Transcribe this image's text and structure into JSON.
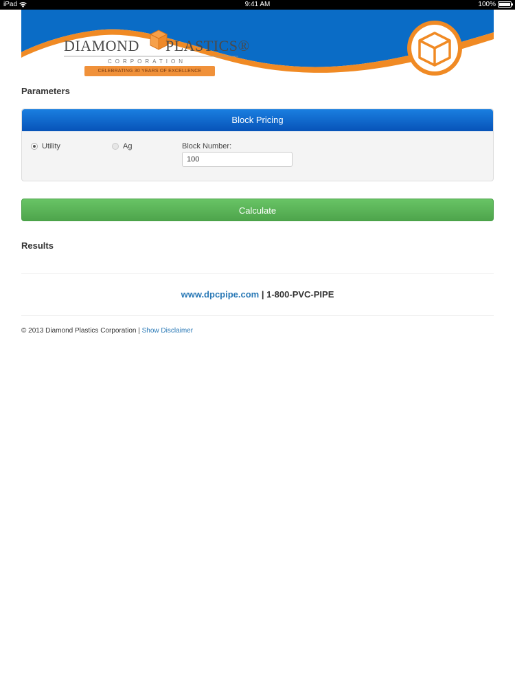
{
  "status_bar": {
    "device": "iPad",
    "time": "9:41 AM",
    "battery": "100%"
  },
  "header": {
    "logo_left": "DIAMOND",
    "logo_right": "PLASTICS®",
    "logo_sub": "CORPORATION",
    "ribbon": "CELEBRATING 30 YEARS OF EXCELLENCE",
    "colors": {
      "blue": "#0a6cc6",
      "orange": "#f08a24"
    }
  },
  "parameters": {
    "title": "Parameters",
    "panel_title": "Block Pricing",
    "radio_options": [
      {
        "label": "Utility",
        "selected": true
      },
      {
        "label": "Ag",
        "selected": false
      }
    ],
    "block_number_label": "Block Number:",
    "block_number_value": "100"
  },
  "actions": {
    "calculate_label": "Calculate"
  },
  "results": {
    "title": "Results"
  },
  "contact": {
    "website": "www.dpcpipe.com",
    "separator": " | ",
    "phone": "1-800-PVC-PIPE"
  },
  "footer": {
    "copyright": "© 2013 Diamond Plastics Corporation | ",
    "disclaimer_link": "Show Disclaimer"
  }
}
